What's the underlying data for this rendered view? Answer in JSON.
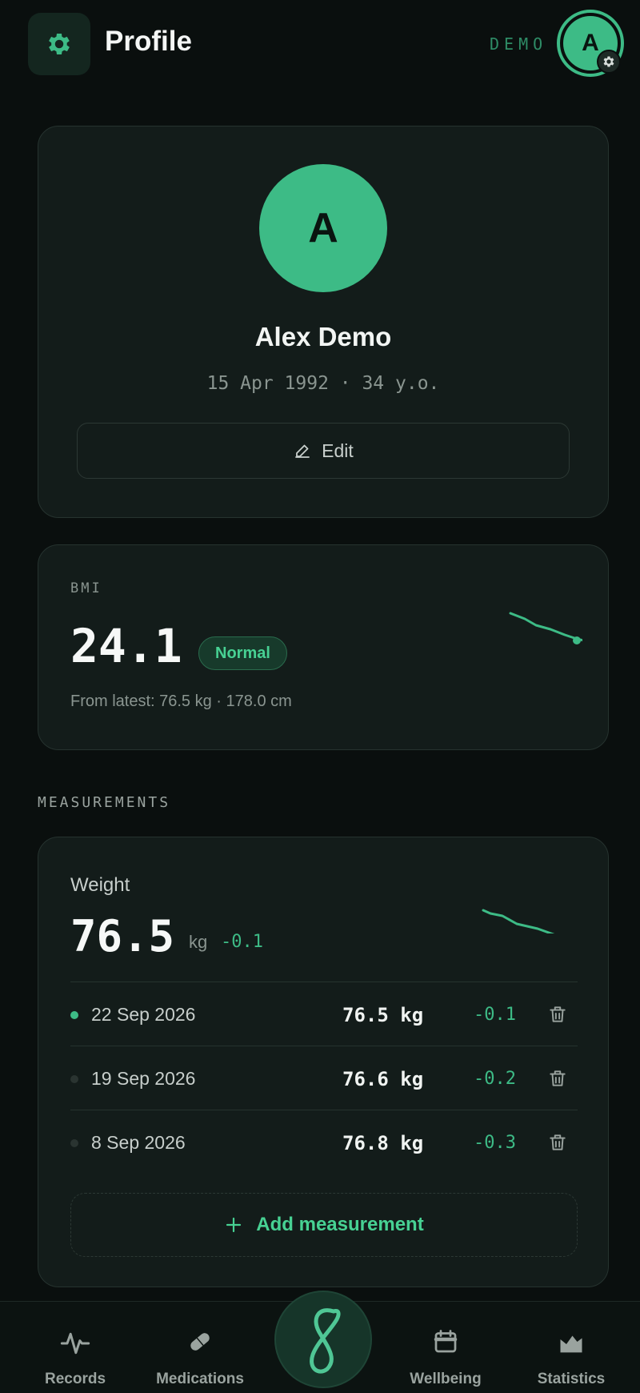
{
  "header": {
    "title": "Profile",
    "mode_label": "DEMO",
    "avatar_initial": "A"
  },
  "profile": {
    "initial": "A",
    "name": "Alex Demo",
    "dob_line": "15 Apr 1992 · 34 y.o.",
    "edit_label": "Edit"
  },
  "bmi": {
    "label": "BMI",
    "value": "24.1",
    "status": "Normal",
    "source": "From latest: 76.5 kg · 178.0 cm"
  },
  "measurements": {
    "section_title": "MEASUREMENTS",
    "weight": {
      "label": "Weight",
      "value": "76.5",
      "unit": "kg",
      "delta": "-0.1",
      "entries": [
        {
          "date": "22 Sep 2026",
          "value": "76.5 kg",
          "delta": "-0.1",
          "latest": true
        },
        {
          "date": "19 Sep 2026",
          "value": "76.6 kg",
          "delta": "-0.2",
          "latest": false
        },
        {
          "date": "8 Sep 2026",
          "value": "76.8 kg",
          "delta": "-0.3",
          "latest": false
        }
      ],
      "add_label": "Add measurement"
    }
  },
  "nav": {
    "records": "Records",
    "medications": "Medications",
    "wellbeing": "Wellbeing",
    "statistics": "Statistics"
  },
  "colors": {
    "accent": "#3dbb86",
    "background": "#0a0f0e",
    "card": "#131c1a"
  }
}
